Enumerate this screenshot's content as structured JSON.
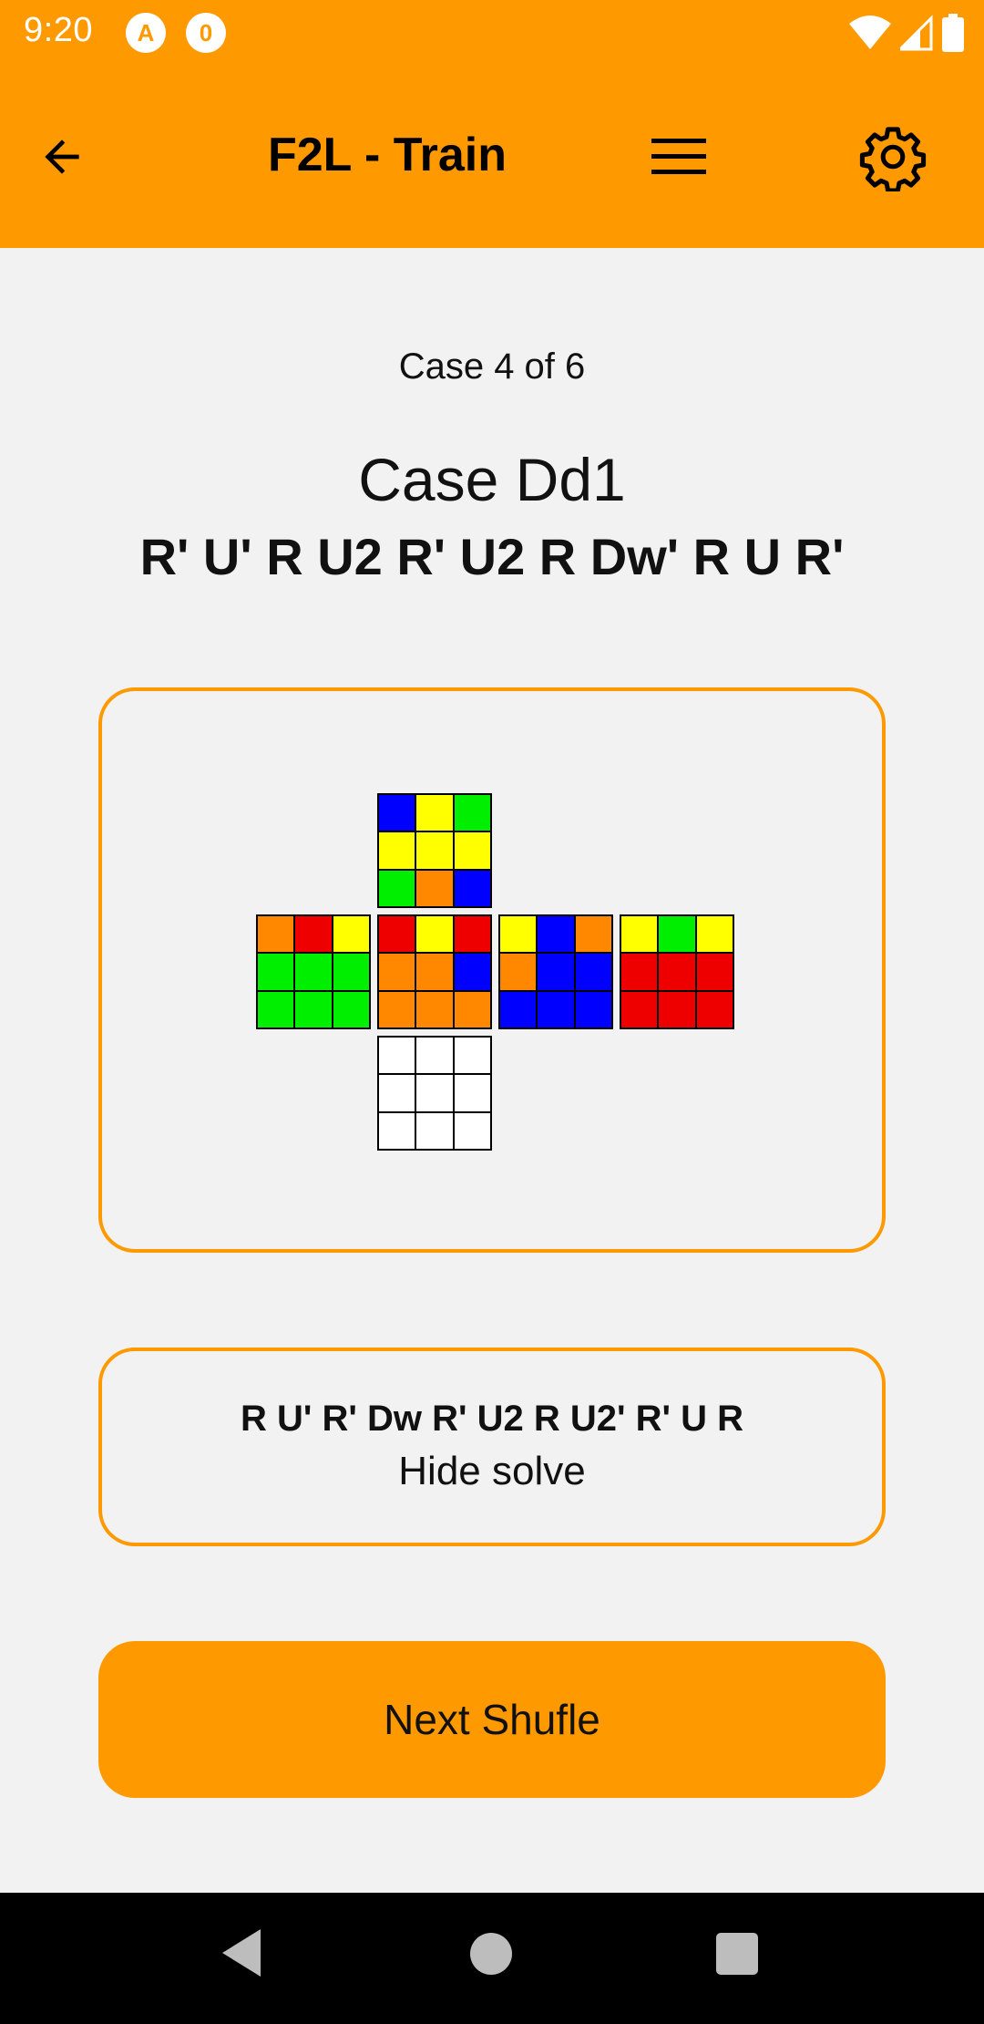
{
  "status_bar": {
    "time": "9:20",
    "app_icons": [
      "A",
      "0"
    ]
  },
  "app_bar": {
    "title": "F2L - Train"
  },
  "case": {
    "counter": "Case 4 of 6",
    "name": "Case Dd1",
    "scramble": "R' U' R U2 R' U2 R Dw' R U R'"
  },
  "colors": {
    "accent": "#ff9900",
    "B": "#0000ff",
    "Y": "#ffff00",
    "G": "#00ee00",
    "O": "#ff8800",
    "R": "#ee0000",
    "W": "#ffffff"
  },
  "cube": {
    "up": [
      "B",
      "Y",
      "G",
      "Y",
      "Y",
      "Y",
      "G",
      "O",
      "B"
    ],
    "left": [
      "O",
      "R",
      "Y",
      "G",
      "G",
      "G",
      "G",
      "G",
      "G"
    ],
    "front": [
      "R",
      "Y",
      "R",
      "O",
      "O",
      "B",
      "O",
      "O",
      "O"
    ],
    "right": [
      "Y",
      "B",
      "O",
      "O",
      "B",
      "B",
      "B",
      "B",
      "B"
    ],
    "back": [
      "Y",
      "G",
      "Y",
      "R",
      "R",
      "R",
      "R",
      "R",
      "R"
    ],
    "down": [
      "W",
      "W",
      "W",
      "W",
      "W",
      "W",
      "W",
      "W",
      "W"
    ]
  },
  "solve": {
    "moves": "R U' R' Dw R' U2 R U2' R' U R",
    "toggle_label": "Hide solve"
  },
  "next_button": {
    "label": "Next Shufle"
  }
}
